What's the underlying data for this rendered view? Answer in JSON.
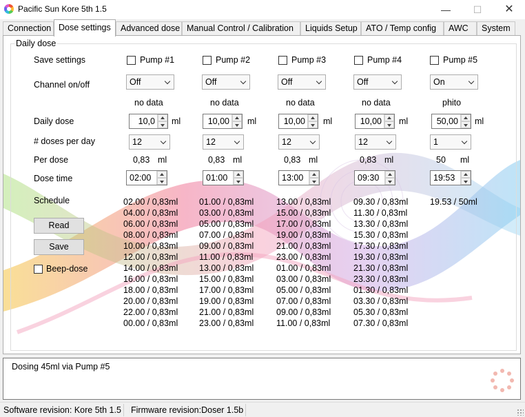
{
  "window": {
    "title": "Pacific Sun Kore 5th 1.5"
  },
  "tabs": [
    "Connection",
    "Dose settings",
    "Advanced dose",
    "Manual Control / Calibration",
    "Liquids Setup",
    "ATO / Temp config",
    "AWC",
    "System"
  ],
  "group": {
    "title": "Daily dose"
  },
  "labels": {
    "save_settings": "Save settings",
    "channel_onoff": "Channel on/off",
    "daily_dose": "Daily dose",
    "doses_per_day": "# doses per day",
    "per_dose": "Per dose",
    "dose_time": "Dose time",
    "schedule": "Schedule",
    "unit_ml": "ml"
  },
  "buttons": {
    "read": "Read",
    "save": "Save"
  },
  "beep": {
    "label": "Beep-dose",
    "checked": false
  },
  "pumps": [
    {
      "name": "Pump #1",
      "onoff": "Off",
      "liquid": "no data",
      "daily_dose": "10,0",
      "doses": "12",
      "per_dose": "0,83",
      "time": "02:00",
      "schedule": [
        "02.00 / 0,83ml",
        "04.00 / 0,83ml",
        "06.00 / 0,83ml",
        "08.00 / 0,83ml",
        "10.00 / 0,83ml",
        "12.00 / 0,83ml",
        "14.00 / 0,83ml",
        "16.00 / 0,83ml",
        "18.00 / 0,83ml",
        "20.00 / 0,83ml",
        "22.00 / 0,83ml",
        "00.00 / 0,83ml"
      ]
    },
    {
      "name": "Pump #2",
      "onoff": "Off",
      "liquid": "no data",
      "daily_dose": "10,00",
      "doses": "12",
      "per_dose": "0,83",
      "time": "01:00",
      "schedule": [
        "01.00 / 0,83ml",
        "03.00 / 0,83ml",
        "05.00 / 0,83ml",
        "07.00 / 0,83ml",
        "09.00 / 0,83ml",
        "11.00 / 0,83ml",
        "13.00 / 0,83ml",
        "15.00 / 0,83ml",
        "17.00 / 0,83ml",
        "19.00 / 0,83ml",
        "21.00 / 0,83ml",
        "23.00 / 0,83ml"
      ]
    },
    {
      "name": "Pump #3",
      "onoff": "Off",
      "liquid": "no data",
      "daily_dose": "10,00",
      "doses": "12",
      "per_dose": "0,83",
      "time": "13:00",
      "schedule": [
        "13.00 / 0,83ml",
        "15.00 / 0,83ml",
        "17.00 / 0,83ml",
        "19.00 / 0,83ml",
        "21.00 / 0,83ml",
        "23.00 / 0,83ml",
        "01.00 / 0,83ml",
        "03.00 / 0,83ml",
        "05.00 / 0,83ml",
        "07.00 / 0,83ml",
        "09.00 / 0,83ml",
        "11.00 / 0,83ml"
      ]
    },
    {
      "name": "Pump #4",
      "onoff": "Off",
      "liquid": "no data",
      "daily_dose": "10,00",
      "doses": "12",
      "per_dose": "0,83",
      "time": "09:30",
      "schedule": [
        "09.30 / 0,83ml",
        "11.30 / 0,83ml",
        "13.30 / 0,83ml",
        "15.30 / 0,83ml",
        "17.30 / 0,83ml",
        "19.30 / 0,83ml",
        "21.30 / 0,83ml",
        "23.30 / 0,83ml",
        "01.30 / 0,83ml",
        "03.30 / 0,83ml",
        "05.30 / 0,83ml",
        "07.30 / 0,83ml"
      ]
    },
    {
      "name": "Pump #5",
      "onoff": "On",
      "liquid": "phito",
      "daily_dose": "50,00",
      "doses": "1",
      "per_dose": "50",
      "time": "19:53",
      "schedule": [
        "19.53 / 50ml"
      ]
    }
  ],
  "log": {
    "text": "Dosing 45ml via Pump #5"
  },
  "status": {
    "software": "Software revision: Kore 5th 1.5",
    "firmware": "Firmware revision:Doser 1.5b"
  }
}
